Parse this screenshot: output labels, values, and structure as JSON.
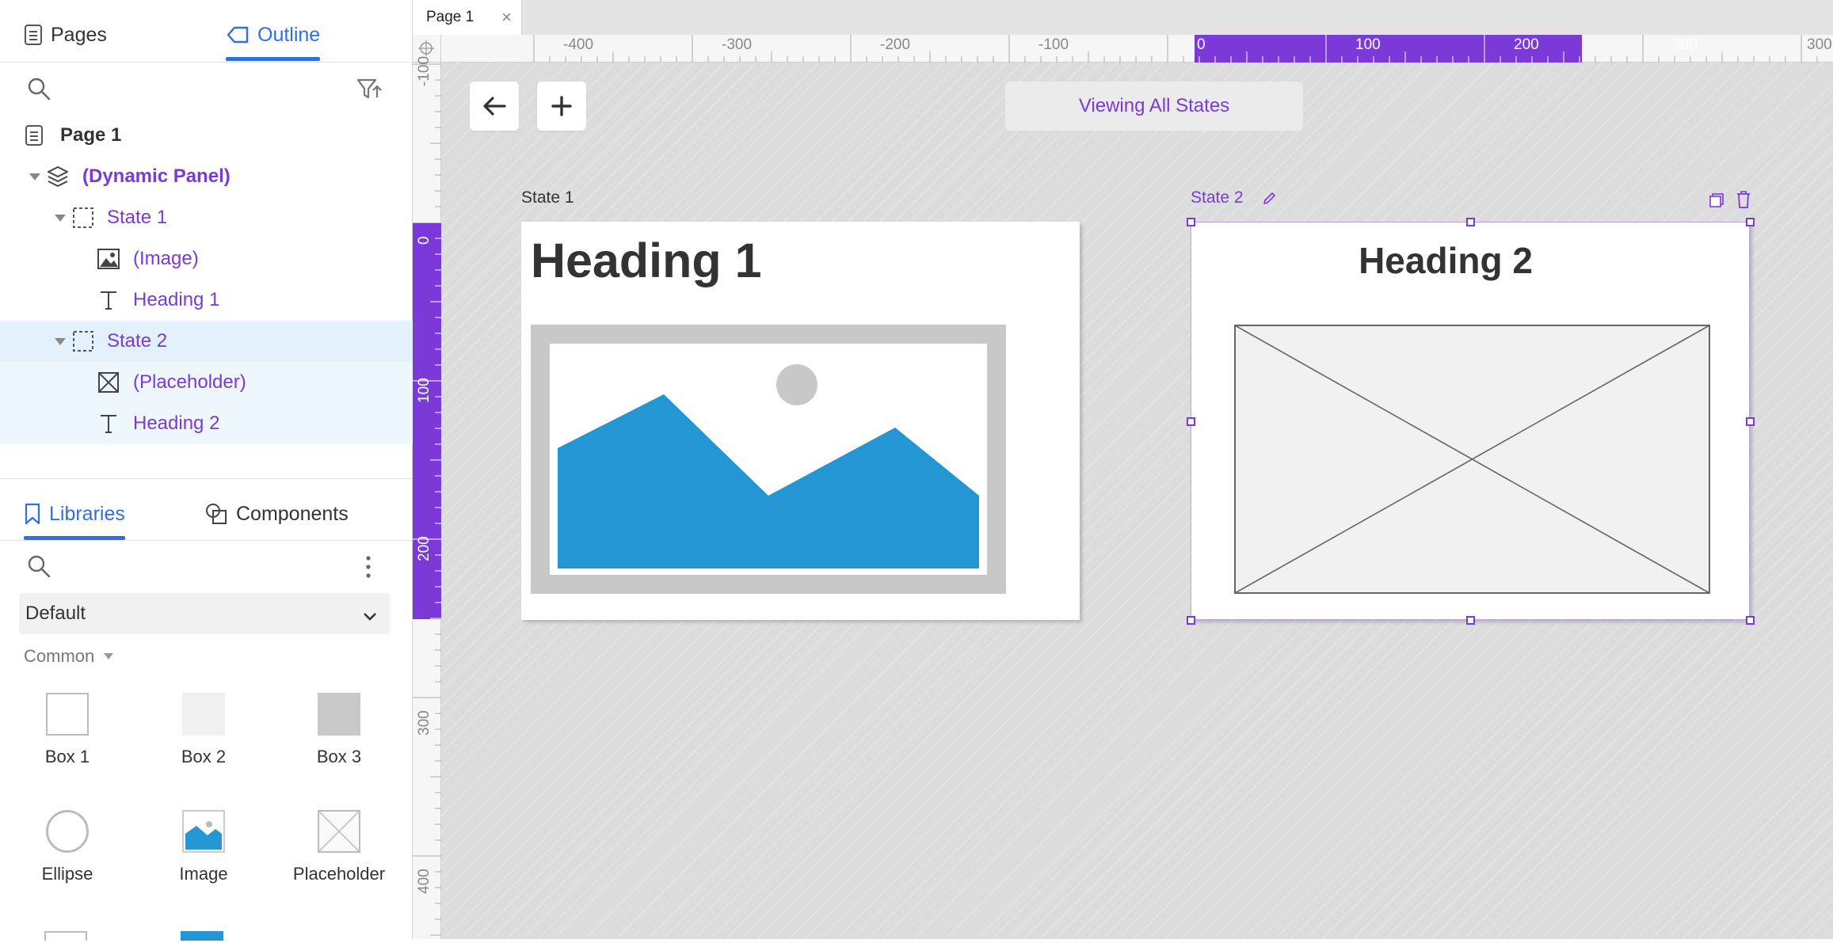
{
  "left_tabs": {
    "pages": "Pages",
    "outline": "Outline"
  },
  "outline_tree": {
    "page": "Page 1",
    "dynamic_panel": "(Dynamic Panel)",
    "state1": "State 1",
    "image": "(Image)",
    "heading1": "Heading 1",
    "state2": "State 2",
    "placeholder": "(Placeholder)",
    "heading2": "Heading 2"
  },
  "lib_tabs": {
    "libraries": "Libraries",
    "components": "Components"
  },
  "library": {
    "selected": "Default",
    "section": "Common",
    "items": [
      "Box 1",
      "Box 2",
      "Box 3",
      "Ellipse",
      "Image",
      "Placeholder"
    ]
  },
  "page_tab": {
    "label": "Page 1",
    "close": "×"
  },
  "ruler": {
    "h_labels": [
      "-400",
      "-300",
      "-200",
      "-100",
      "0",
      "100",
      "200",
      "300",
      "300"
    ],
    "v_labels": [
      "-100",
      "0",
      "100",
      "200",
      "300",
      "400"
    ]
  },
  "canvas": {
    "viewing": "Viewing All States",
    "state1_label": "State 1",
    "state2_label": "State 2",
    "heading1": "Heading 1",
    "heading2": "Heading 2"
  },
  "colors": {
    "accent": "#7b3ad8",
    "tab_blue": "#2f6fe0",
    "image_blue": "#2596d4",
    "selection": "#e3f1fd"
  }
}
